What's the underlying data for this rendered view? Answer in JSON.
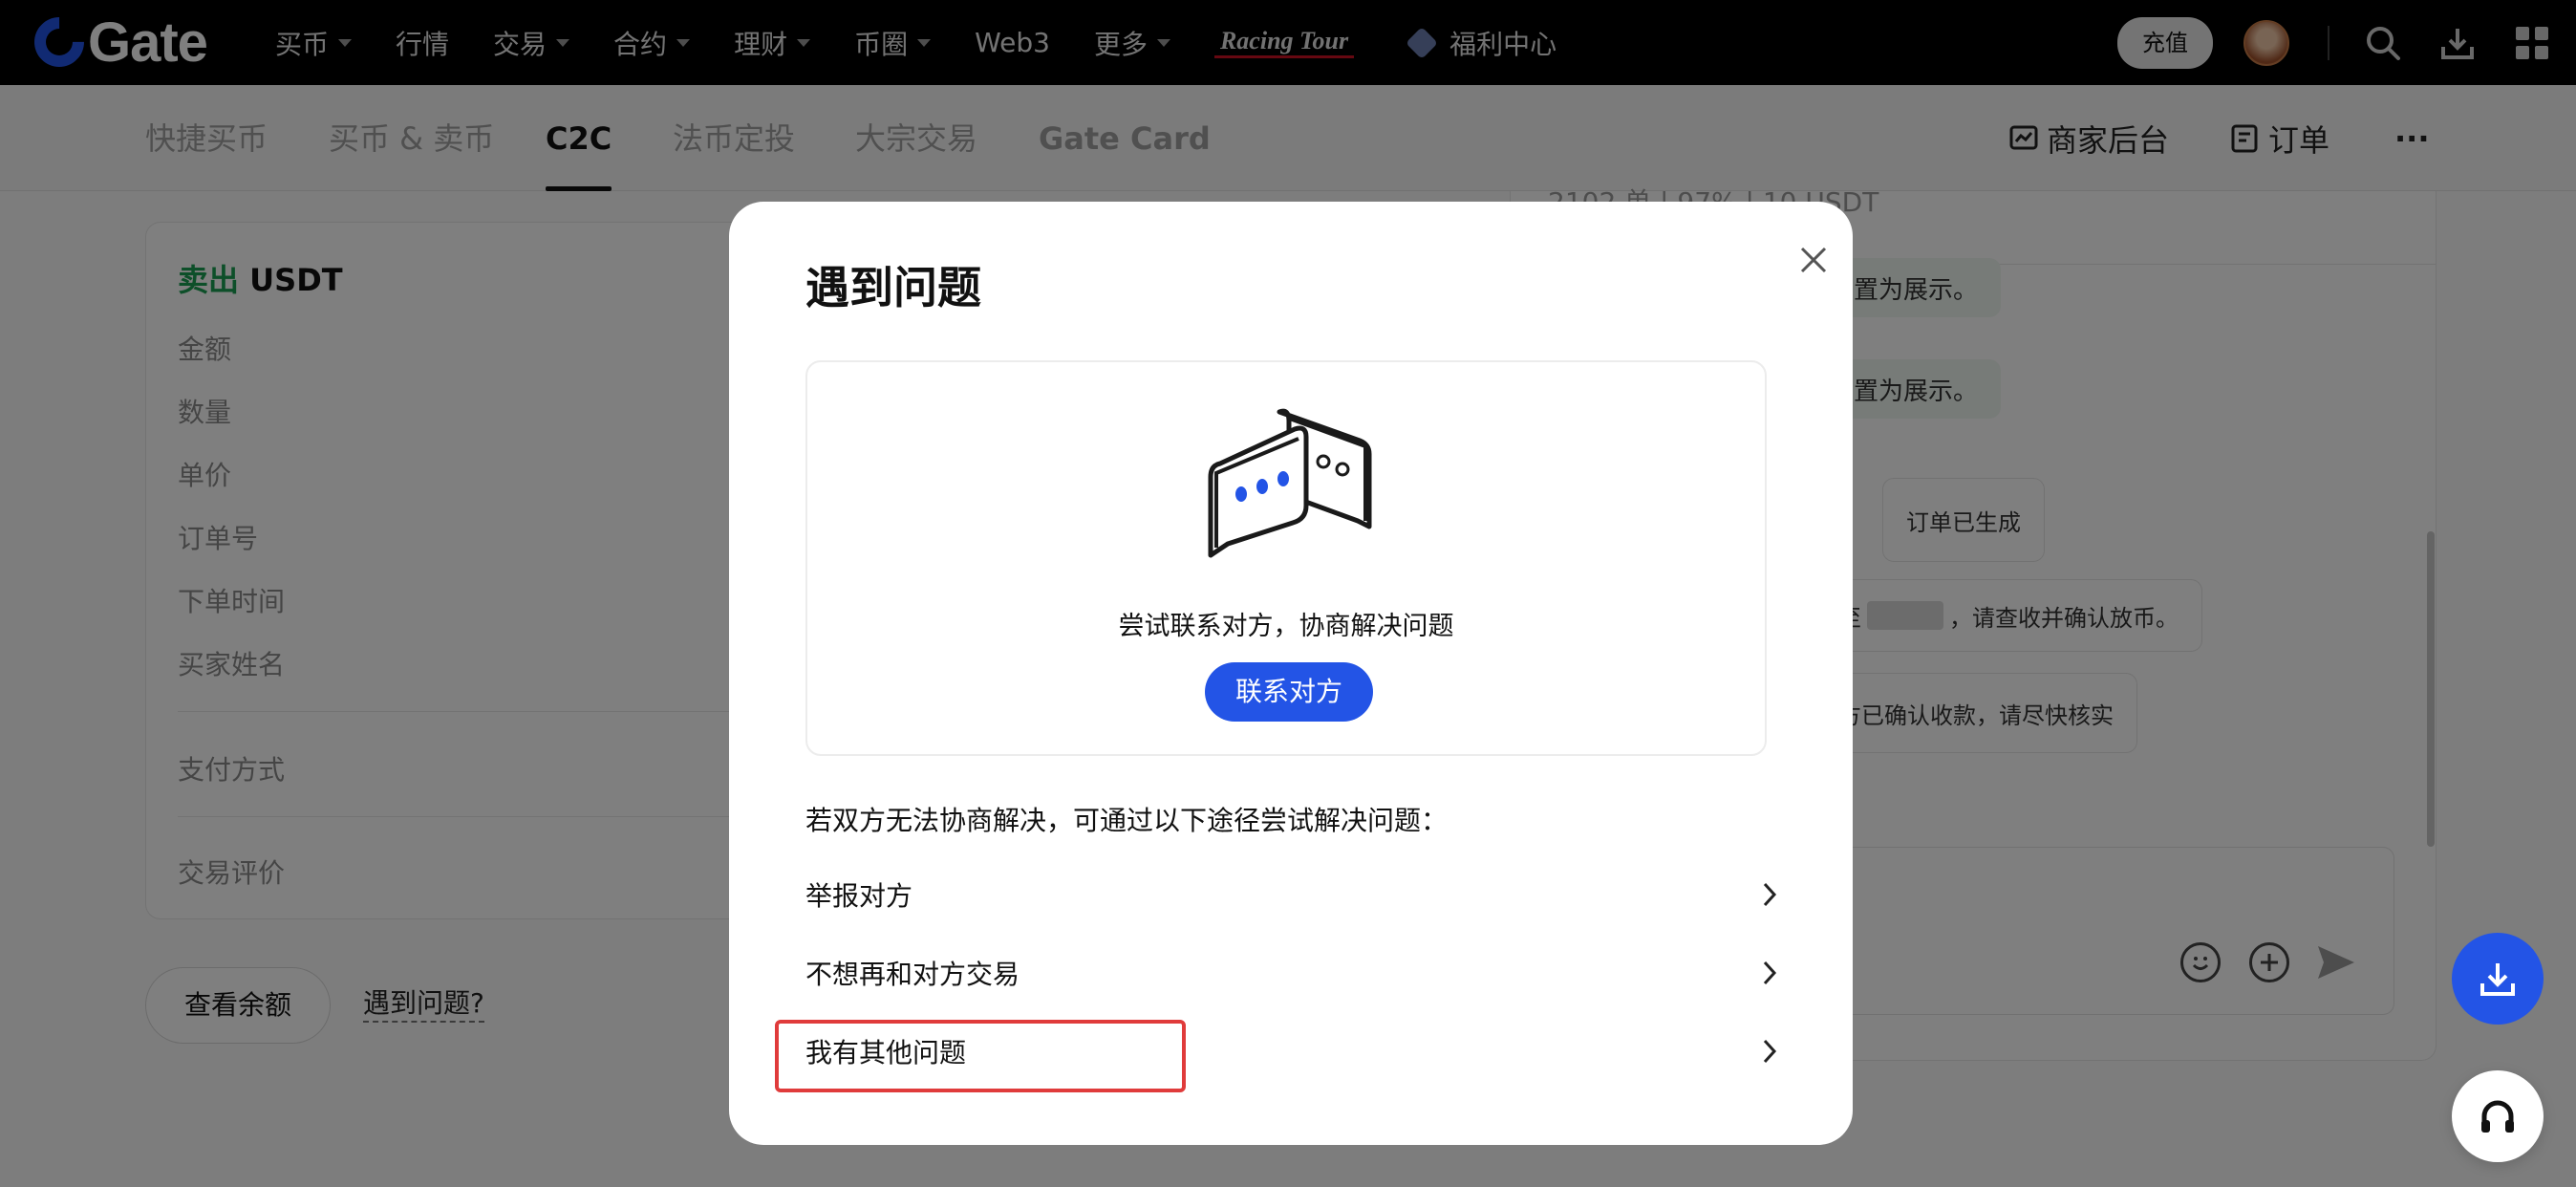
{
  "topnav": {
    "logo_text": "Gate",
    "items": [
      {
        "label": "买币",
        "dropdown": true
      },
      {
        "label": "行情",
        "dropdown": false
      },
      {
        "label": "交易",
        "dropdown": true
      },
      {
        "label": "合约",
        "dropdown": true
      },
      {
        "label": "理财",
        "dropdown": true
      },
      {
        "label": "币圈",
        "dropdown": true
      },
      {
        "label": "Web3",
        "dropdown": false
      },
      {
        "label": "更多",
        "dropdown": true
      }
    ],
    "racing_label": "Racing Tour",
    "welfare_label": "福利中心",
    "deposit_label": "充值",
    "icons": [
      "search-icon",
      "download-icon",
      "apps-grid-icon"
    ]
  },
  "subnav": {
    "tabs": [
      "快捷买币",
      "买币 & 卖币",
      "C2C",
      "法币定投",
      "大宗交易",
      "Gate Card"
    ],
    "active_tab": "C2C",
    "merchant_label": "商家后台",
    "orders_label": "订单",
    "more_label": "···"
  },
  "order": {
    "title_action": "卖出",
    "title_asset": "USDT",
    "fields": [
      "金额",
      "数量",
      "单价",
      "订单号",
      "下单时间",
      "买家姓名"
    ],
    "payment_label": "支付方式",
    "review_label": "交易评价",
    "balance_button": "查看余额",
    "problem_link": "遇到问题?"
  },
  "chat": {
    "header_partial": "2102 单 | 97% | 10 USDT",
    "bubble1": "设置为展示。",
    "bubble2": "设置为展示。",
    "sys_created": "订单已生成",
    "sys_confirm_prefix": "至",
    "sys_confirm_suffix": "，请查收并确认放币。",
    "sys_received": "方已确认收款，请尽快核实"
  },
  "modal": {
    "title": "遇到问题",
    "contact_hint": "尝试联系对方，协商解决问题",
    "contact_button": "联系对方",
    "alternative_text": "若双方无法协商解决，可通过以下途径尝试解决问题：",
    "options": [
      "举报对方",
      "不想再和对方交易",
      "我有其他问题"
    ]
  },
  "colors": {
    "brand_blue": "#2354e6",
    "sell_green": "#1a9f52",
    "highlight_red": "#e03b3b"
  }
}
